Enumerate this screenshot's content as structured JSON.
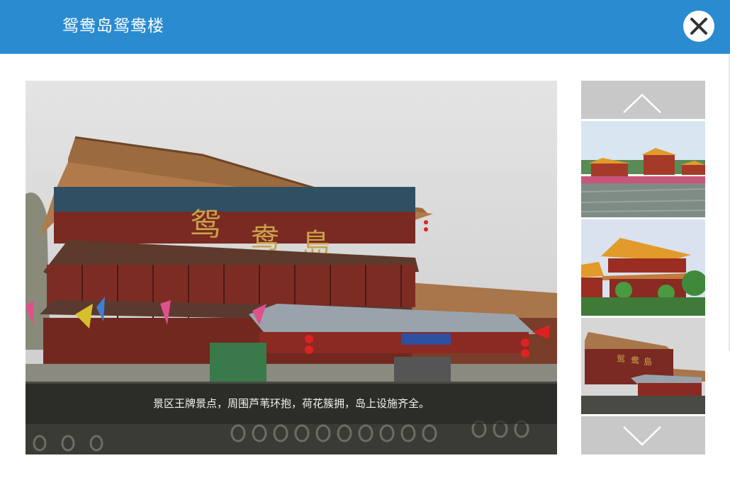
{
  "header": {
    "title": "鸳鸯岛鸳鸯楼",
    "background_color": "#2a8bd0",
    "close_icon": "close-icon"
  },
  "gallery": {
    "caption": "景区王牌景点，周围芦苇环抱，荷花簇拥，岛上设施齐全。",
    "sign_characters": [
      "鸳",
      "鸯",
      "島"
    ],
    "thumbnails": [
      {
        "name": "thumb-waterfront-pavilions"
      },
      {
        "name": "thumb-tower-garden"
      },
      {
        "name": "thumb-tower-pier"
      }
    ],
    "scroll_up_icon": "chevron-up-icon",
    "scroll_down_icon": "chevron-down-icon"
  }
}
